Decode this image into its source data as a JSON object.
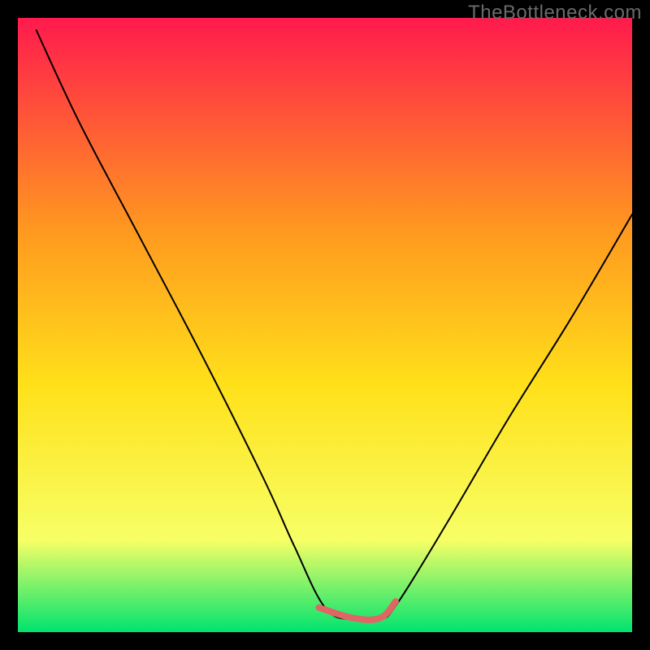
{
  "watermark": "TheBottleneck.com",
  "colors": {
    "background_black": "#000000",
    "gradient_top": "#ff1a4d",
    "gradient_upper_mid": "#ff9a1f",
    "gradient_mid": "#ffe11a",
    "gradient_lower_mid": "#f7ff66",
    "gradient_bottom": "#00e36e",
    "curve_main": "#000000",
    "trough_highlight": "#e06666"
  },
  "chart_data": {
    "type": "line",
    "title": "",
    "xlabel": "",
    "ylabel": "",
    "xlim": [
      0,
      1
    ],
    "ylim": [
      0,
      1
    ],
    "series": [
      {
        "name": "main-curve",
        "x": [
          0.03,
          0.1,
          0.2,
          0.3,
          0.4,
          0.45,
          0.5,
          0.545,
          0.59,
          0.62,
          0.7,
          0.8,
          0.9,
          1.0
        ],
        "y": [
          0.98,
          0.83,
          0.64,
          0.45,
          0.25,
          0.14,
          0.04,
          0.02,
          0.02,
          0.05,
          0.18,
          0.35,
          0.51,
          0.68
        ]
      },
      {
        "name": "trough-highlight",
        "x": [
          0.49,
          0.545,
          0.59,
          0.615
        ],
        "y": [
          0.04,
          0.023,
          0.023,
          0.05
        ]
      }
    ],
    "annotations": [
      {
        "text": "TheBottleneck.com",
        "position": "top-right"
      }
    ]
  }
}
